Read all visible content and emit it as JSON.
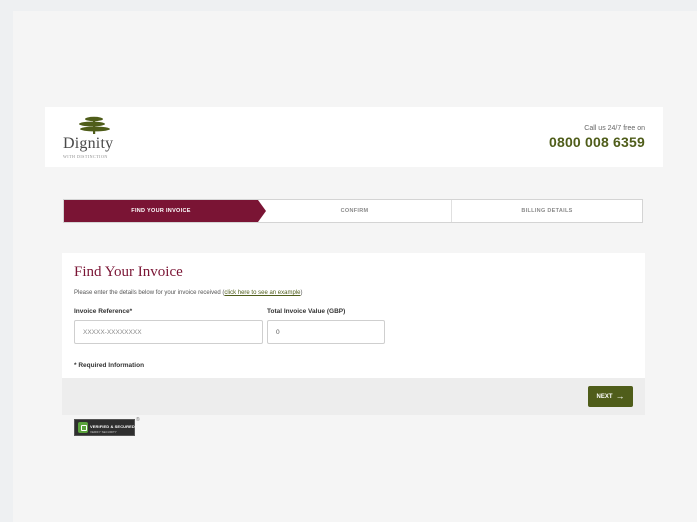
{
  "header": {
    "logo_word": "Dignity",
    "logo_tag": "WITH DISTINCTION",
    "call_text": "Call us 24/7 free on",
    "phone": "0800 008 6359"
  },
  "steps": [
    {
      "label": "FIND YOUR INVOICE",
      "active": true
    },
    {
      "label": "CONFIRM",
      "active": false
    },
    {
      "label": "BILLING DETAILS",
      "active": false
    }
  ],
  "form": {
    "title": "Find Your Invoice",
    "description": "Please enter the details below for your invoice received (",
    "example_link": "click here to see an example",
    "description_end": ")",
    "invoice_ref_label": "Invoice Reference*",
    "invoice_ref_placeholder": "XXXXX-XXXXXXXX",
    "invoice_ref_value": "",
    "total_label": "Total Invoice Value (GBP)",
    "total_value": "0",
    "required_note": "* Required Information",
    "next_label": "NEXT",
    "next_arrow": "→"
  },
  "seal": {
    "text": "VERIFIED & SECURED",
    "sub": "VERIFY SECURITY",
    "reg": "®"
  },
  "colors": {
    "brand_maroon": "#7a1434",
    "brand_green": "#4f5d1a",
    "seal_green": "#5aa33b"
  },
  "icons": {
    "logo": "tree-icon",
    "next": "arrow-right-icon",
    "seal": "shield-icon"
  }
}
